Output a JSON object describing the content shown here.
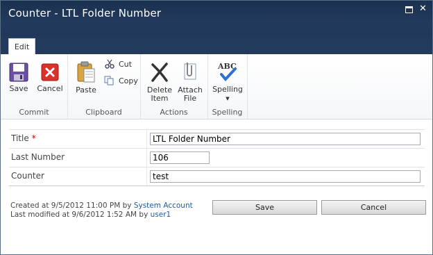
{
  "window": {
    "title": "Counter - LTL Folder Number"
  },
  "ribbon": {
    "tab": "Edit",
    "groups": {
      "commit": {
        "label": "Commit",
        "save": "Save",
        "cancel": "Cancel"
      },
      "clipboard": {
        "label": "Clipboard",
        "paste": "Paste",
        "cut": "Cut",
        "copy": "Copy"
      },
      "actions": {
        "label": "Actions",
        "delete_line1": "Delete",
        "delete_line2": "Item",
        "attach_line1": "Attach",
        "attach_line2": "File"
      },
      "spelling": {
        "label": "Spelling",
        "spelling": "Spelling",
        "icon_text": "ABC"
      }
    }
  },
  "form": {
    "fields": [
      {
        "label": "Title",
        "required_marker": "*",
        "value": "LTL Folder Number"
      },
      {
        "label": "Last Number",
        "value": "106"
      },
      {
        "label": "Counter",
        "value": "test"
      }
    ]
  },
  "footer": {
    "created_prefix": "Created at 9/5/2012 11:00 PM by ",
    "created_by": "System Account",
    "modified_prefix": "Last modified at 9/6/2012 1:52 AM by ",
    "modified_by": "user1",
    "save": "Save",
    "cancel": "Cancel"
  },
  "colors": {
    "titlebar": "#223a5c",
    "link": "#1e5aa0",
    "required": "#bf0000"
  }
}
